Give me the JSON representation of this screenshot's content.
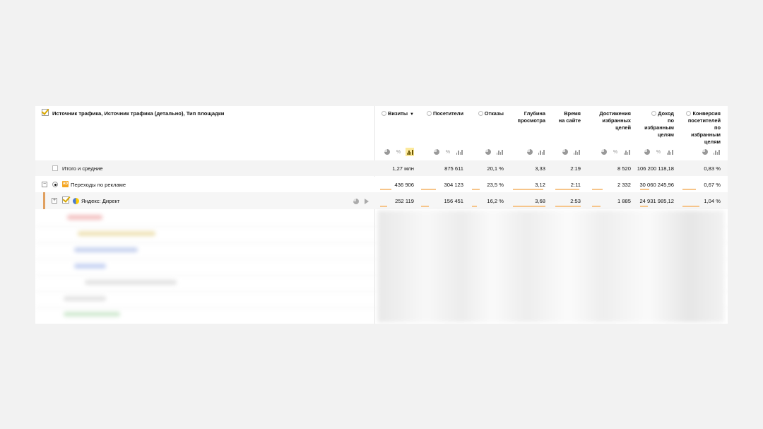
{
  "header": {
    "dimension_title": "Источник трафика, Источник трафика (детально), Тип площадки",
    "columns": [
      {
        "id": "visits",
        "lines": [
          "Визиты"
        ],
        "sorted": true,
        "sort_arrow": "▼"
      },
      {
        "id": "visitors",
        "lines": [
          "Посетители"
        ]
      },
      {
        "id": "bounces",
        "lines": [
          "Отказы"
        ]
      },
      {
        "id": "depth",
        "lines": [
          "Глубина",
          "просмотра"
        ]
      },
      {
        "id": "time",
        "lines": [
          "Время",
          "на сайте"
        ]
      },
      {
        "id": "goals",
        "lines": [
          "Достижения",
          "избранных",
          "целей"
        ]
      },
      {
        "id": "income",
        "lines": [
          "Доход",
          "по",
          "избранным",
          "целям"
        ]
      },
      {
        "id": "conversion",
        "lines": [
          "Конверсия",
          "посетителей",
          "по",
          "избранным",
          "целям"
        ]
      }
    ]
  },
  "rows": {
    "total": {
      "label": "Итого и средние",
      "values": [
        "1,27 млн",
        "875 611",
        "20,1 %",
        "3,33",
        "2:19",
        "8 520",
        "106 200 118,18",
        "0,83 %"
      ]
    },
    "ads": {
      "label": "Переходы по рекламе",
      "badge": "AD",
      "values": [
        "436 906",
        "304 123",
        "23,5 %",
        "3,12",
        "2:11",
        "2 332",
        "30 060 245,96",
        "0,67 %"
      ],
      "bar_fraction": [
        0.34,
        0.35,
        0.23,
        0.93,
        0.94,
        0.27,
        0.28,
        0.8
      ]
    },
    "direct": {
      "label": "Яндекс: Директ",
      "values": [
        "252 119",
        "156 451",
        "16,2 %",
        "3,68",
        "2:53",
        "1 885",
        "24 931 985,12",
        "1,04 %"
      ],
      "bar_fraction": [
        0.2,
        0.18,
        0.16,
        1.0,
        1.0,
        0.22,
        0.23,
        1.0
      ]
    }
  },
  "colors": {
    "accent_bar": "#f7c58a",
    "row_accent": "#e0a060",
    "active_icon_bg": "#fce99c",
    "checkmark": "#d9a800"
  },
  "toggles": {
    "ads": "−",
    "direct": "+"
  }
}
